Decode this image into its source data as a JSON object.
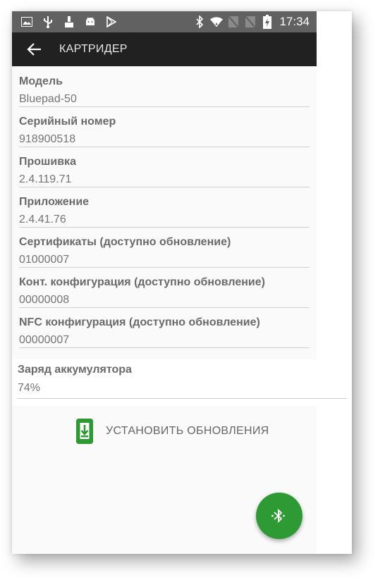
{
  "status_bar": {
    "time": "17:34",
    "left_icons": [
      "image-icon",
      "usb-icon",
      "cleaning-icon",
      "android-icon",
      "play-store-icon"
    ],
    "right_icons": [
      "bluetooth-icon",
      "wifi-icon",
      "no-sim-icon",
      "no-sim-icon",
      "battery-charging-icon"
    ]
  },
  "app_bar": {
    "back_icon": "arrow-left-icon",
    "title": "КАРТРИДЕР"
  },
  "info": {
    "items": [
      {
        "label": "Модель",
        "value": "Bluepad-50"
      },
      {
        "label": "Серийный номер",
        "value": "918900518"
      },
      {
        "label": "Прошивка",
        "value": "2.4.119.71"
      },
      {
        "label": "Приложение",
        "value": "2.4.41.76"
      },
      {
        "label": "Сертификаты (доступно обновление)",
        "value": "01000007"
      },
      {
        "label": "Конт. конфигурация (доступно обновление)",
        "value": "00000008"
      },
      {
        "label": "NFC конфигурация (доступно обновление)",
        "value": "00000007"
      }
    ],
    "battery": {
      "label": "Заряд аккумулятора",
      "value": "74%"
    }
  },
  "actions": {
    "install_label": "УСТАНОВИТЬ ОБНОВЛЕНИЯ",
    "install_icon": "phone-download-icon",
    "fab_icon": "bluetooth-searching-icon"
  },
  "colors": {
    "status_bar": "#616161",
    "app_bar": "#212121",
    "accent_green": "#2e9a34",
    "background": "#fafafa"
  }
}
